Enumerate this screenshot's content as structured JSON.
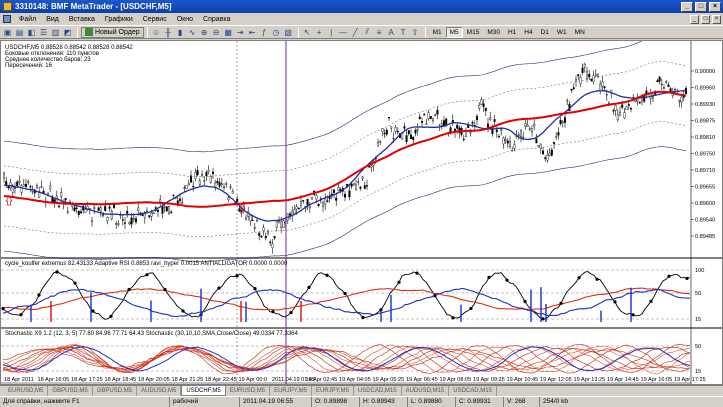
{
  "window": {
    "title": "3310148: BMF MetaTrader - [USDCHF,M5]"
  },
  "menu": [
    "Файл",
    "Вид",
    "Вставка",
    "Графики",
    "Сервис",
    "Окно",
    "Справка"
  ],
  "toolbar": {
    "new_order_label": "Новый Ордер"
  },
  "timeframes": [
    {
      "label": "M1",
      "active": false
    },
    {
      "label": "M5",
      "active": true
    },
    {
      "label": "M15",
      "active": false
    },
    {
      "label": "M30",
      "active": false
    },
    {
      "label": "H1",
      "active": false
    },
    {
      "label": "H4",
      "active": false
    },
    {
      "label": "D1",
      "active": false
    },
    {
      "label": "W1",
      "active": false
    },
    {
      "label": "MN",
      "active": false
    }
  ],
  "main_info": [
    "USDCHF,M5  0.88528 0.88542 0.88528 0.88542",
    "Боковые отклонения: 110 пунктов",
    "Среднее количество баров: 23",
    "Пересечений: 16"
  ],
  "price_labels": [
    "0.90000",
    "0.89960",
    "0.89930",
    "0.89875",
    "0.89810",
    "0.89750",
    "0.89710",
    "0.89655",
    "0.89600",
    "0.89540",
    "0.89485"
  ],
  "panel2": {
    "info": "cycle_koulfer extremus 82.43133  Adaptive RSI 0.8853  ravi_hyper 0.0015  ANTIALLIGATOR 0.0000 0.0000",
    "labels": [
      "100",
      "50",
      "15"
    ]
  },
  "panel3": {
    "info": "Stochastic X9 1.2 (12, 3, 5) 77.80 84.96 77.71 64.43  Stochastic (30,10,10,SMA,Close/Close) 49.0334 77.3364",
    "labels": [
      "50",
      "15"
    ]
  },
  "time_labels": [
    "18 Apr 2011",
    "18 Apr 16:05",
    "18 Apr 17:25",
    "18 Apr 18:45",
    "18 Apr 20:05",
    "18 Apr 21:25",
    "18 Apr 22:45",
    "19 Apr 00:0",
    "2011.04.19 01:45",
    "19 Apr 02:45",
    "19 Apr 04:05",
    "19 Apr 05:25",
    "19 Apr 06:45",
    "19 Apr 08:05",
    "19 Apr 09:25",
    "19 Apr 10:45",
    "19 Apr 12:05",
    "19 Apr 13:25",
    "19 Apr 14:45",
    "19 Apr 16:05",
    "19 Apr 17:25"
  ],
  "tabs": [
    {
      "label": "EURUSD,M5",
      "active": false
    },
    {
      "label": "GBPUSD,M5",
      "active": false
    },
    {
      "label": "GBPUSD,M5",
      "active": false
    },
    {
      "label": "AUDUSD,M5",
      "active": false
    },
    {
      "label": "USDCHF,M5",
      "active": true
    },
    {
      "label": "EURUSD,M5",
      "active": false
    },
    {
      "label": "EURJPY,M5",
      "active": false
    },
    {
      "label": "EURJPY,M5",
      "active": false
    },
    {
      "label": "USDCAD,M15",
      "active": false
    },
    {
      "label": "AUDUSD,M15",
      "active": false
    },
    {
      "label": "USDCAD,M15",
      "active": false
    }
  ],
  "status": {
    "help": "Для справки, нажмите F1",
    "profile": "рабочий",
    "datetime": "2011.04.19 06:55",
    "open": "O: 0.89898",
    "high": "H: 0.89943",
    "low": "L: 0.89880",
    "close": "C: 0.89931",
    "volume": "V: 268",
    "traffic": "254/0 kb"
  },
  "colors": {
    "bull_bear": "#000000",
    "ma_slow": "#e00000",
    "ma_fast": "#1f2f9a",
    "channel": "#2a2a6a",
    "cursor": "#6a2aa0",
    "stoch_main": "#e03010",
    "stoch_signal": "#2030c0"
  }
}
